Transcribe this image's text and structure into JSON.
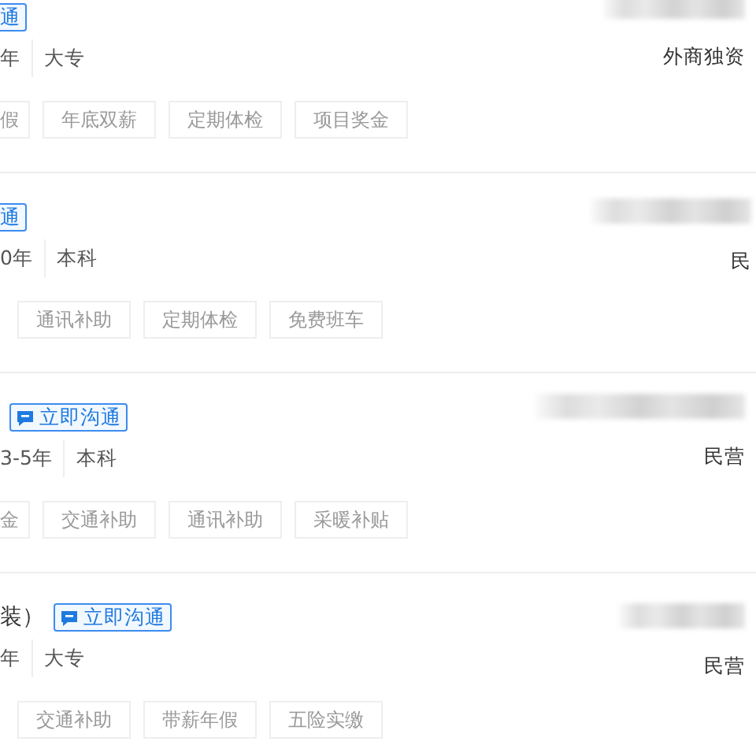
{
  "jobs": [
    {
      "chat_button": "通",
      "experience": "年",
      "education": "大专",
      "benefits": [
        "假",
        "年底双薪",
        "定期体检",
        "项目奖金"
      ],
      "company_type": "外商独资"
    },
    {
      "chat_button": "通",
      "experience": "0年",
      "education": "本科",
      "benefits": [
        "通讯补助",
        "定期体检",
        "免费班车"
      ],
      "company_type": "民"
    },
    {
      "chat_button": "立即沟通",
      "experience": "3-5年",
      "education": "本科",
      "benefits": [
        "金",
        "交通补助",
        "通讯补助",
        "采暖补贴"
      ],
      "company_type": "民营"
    },
    {
      "title": "装）",
      "chat_button": "立即沟通",
      "experience": "年",
      "education": "大专",
      "benefits": [
        "交通补助",
        "带薪年假",
        "五险实缴"
      ],
      "company_type": "民营"
    }
  ]
}
